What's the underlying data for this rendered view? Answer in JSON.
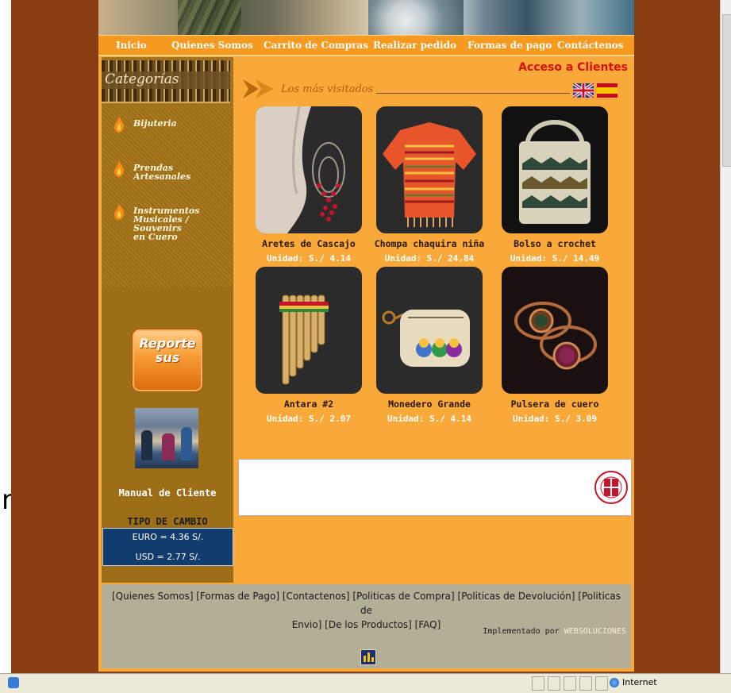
{
  "nav": {
    "items": [
      "Inicio",
      "Quienes Somos",
      "Carrito de Compras",
      "Realizar pedido",
      "Formas de pago",
      "Contáctenos"
    ]
  },
  "sidebar": {
    "title": "Categorías",
    "categories": [
      {
        "label_lines": [
          "Bijuteria"
        ]
      },
      {
        "label_lines": [
          "Prendas Artesanales"
        ]
      },
      {
        "label_lines": [
          "Instrumentos",
          "Musicales / Souvenirs",
          "en Cuero"
        ]
      }
    ],
    "reporte": [
      "Reporte",
      "sus"
    ],
    "manual_label": "Manual de Cliente",
    "exchange": {
      "title": "TIPO DE CAMBIO",
      "euro": "EURO = 4.36 S/.",
      "usd": "USD = 2.77 S/."
    }
  },
  "main": {
    "acceso": "Acceso a Clientes",
    "section_title": "Los más visitados",
    "products": [
      {
        "name": "Aretes de Cascajo",
        "price": "Unidad: S./ 4.14",
        "icon": "earring-image"
      },
      {
        "name": "Chompa chaquira niña",
        "price": "Unidad: S./ 24.84",
        "icon": "sweater-image"
      },
      {
        "name": "Bolso a crochet",
        "price": "Unidad: S./ 14.49",
        "icon": "bag-image"
      },
      {
        "name": "Antara #2",
        "price": "Unidad: S./ 2.07",
        "icon": "panflute-image"
      },
      {
        "name": "Monedero Grande",
        "price": "Unidad: S./ 4.14",
        "icon": "purse-image"
      },
      {
        "name": "Pulsera de cuero",
        "price": "Unidad: S./ 3.09",
        "icon": "bracelet-image"
      }
    ]
  },
  "footer": {
    "links_line1": "[Quienes Somos] [Formas de Pago] [Contactenos] [Politicas de Compra] [Politicas de Devolución] [Politicas de",
    "links_line2": "Envio] [De los Productos] [FAQ]",
    "implemented_prefix": "Implementado por",
    "implemented_brand": "WEBSOLUCIONES"
  },
  "statusbar": {
    "zone": "Internet"
  },
  "colors": {
    "outer_bg": "#8a3c12",
    "page_bg": "#f8a93a",
    "nav_bg": "#f59a1e",
    "sidebar_bg": "#9c6e18",
    "accent_red": "#d6100a",
    "rates_bg": "#123c6e",
    "footer_bg": "#b3ae96"
  }
}
